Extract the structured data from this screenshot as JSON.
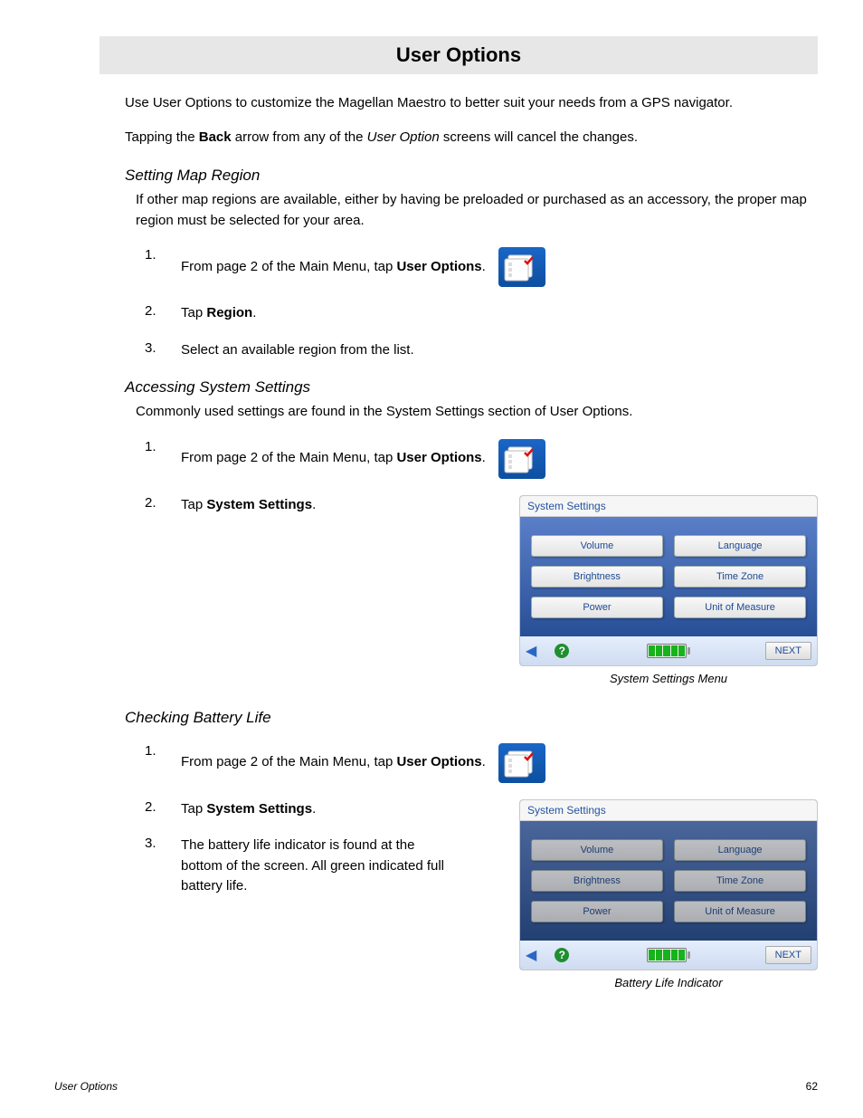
{
  "title": "User Options",
  "intro_line1": "Use User Options to customize the Magellan Maestro to better suit your needs from a GPS navigator.",
  "intro_line2_pre": "Tapping the ",
  "intro_line2_bold": "Back",
  "intro_line2_mid": " arrow from any of the ",
  "intro_line2_italic": "User Option",
  "intro_line2_post": " screens will cancel the changes.",
  "sections": {
    "region": {
      "heading": "Setting Map Region",
      "body": "If other map regions are available, either by having be preloaded or purchased as an accessory, the proper map region must be selected for your area.",
      "steps": {
        "s1_pre": "From page 2 of the Main Menu, tap ",
        "s1_bold": "User Options",
        "s1_post": ".",
        "s2_pre": "Tap ",
        "s2_bold": "Region",
        "s2_post": ".",
        "s3": "Select an available region from the list."
      }
    },
    "system": {
      "heading": "Accessing System Settings",
      "body": "Commonly used settings are found in the System Settings section of User Options.",
      "steps": {
        "s1_pre": "From page 2 of the Main Menu, tap ",
        "s1_bold": "User Options",
        "s1_post": ".",
        "s2_pre": "Tap ",
        "s2_bold": "System Settings",
        "s2_post": "."
      }
    },
    "battery": {
      "heading": "Checking Battery Life",
      "steps": {
        "s1_pre": "From page 2 of the Main Menu, tap ",
        "s1_bold": "User Options",
        "s1_post": ".",
        "s2_pre": "Tap ",
        "s2_bold": "System Settings",
        "s2_post": ".",
        "s3": "The battery life indicator is found at the bottom of the screen.  All green indicated full battery life."
      }
    }
  },
  "screenshot": {
    "title": "System Settings",
    "buttons": {
      "volume": "Volume",
      "language": "Language",
      "brightness": "Brightness",
      "timezone": "Time Zone",
      "power": "Power",
      "uom": "Unit of Measure"
    },
    "next": "NEXT",
    "caption1": "System Settings Menu",
    "caption2": "Battery Life Indicator"
  },
  "footer": {
    "left": "User Options",
    "right": "62"
  }
}
